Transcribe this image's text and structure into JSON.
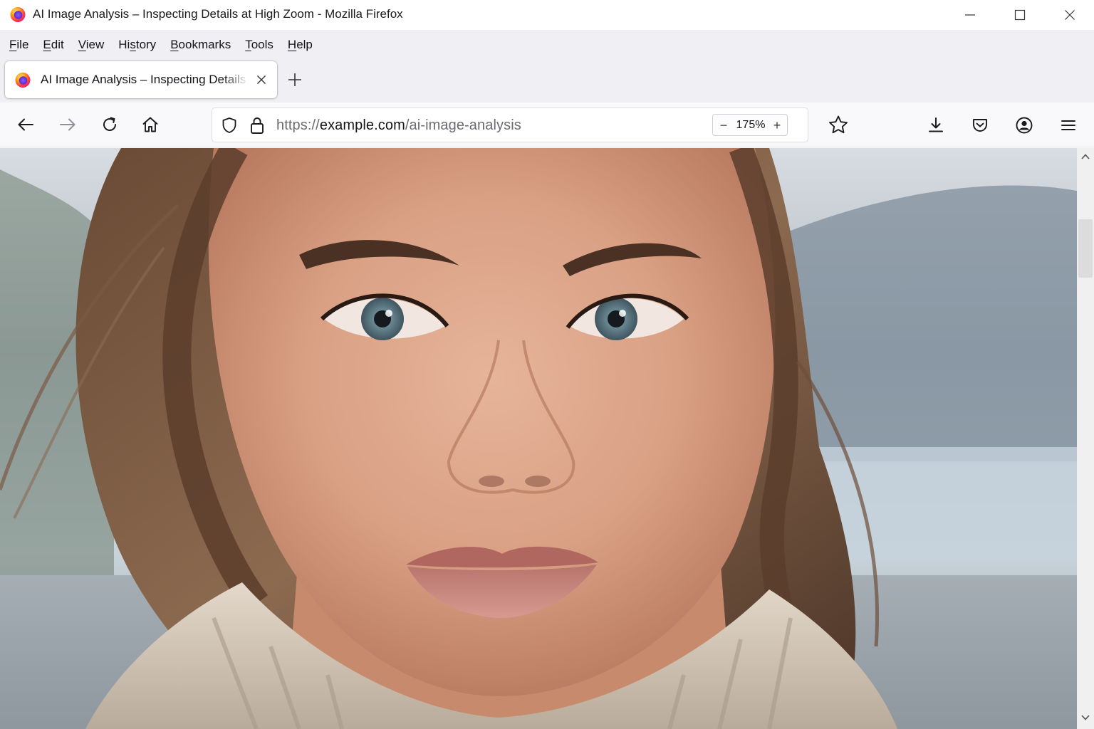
{
  "window": {
    "title": "AI Image Analysis – Inspecting Details at High Zoom - Mozilla Firefox",
    "controls": [
      "minimize",
      "maximize",
      "close"
    ]
  },
  "menu": {
    "items": [
      {
        "mnemonic": "F",
        "rest": "ile"
      },
      {
        "mnemonic": "E",
        "rest": "dit"
      },
      {
        "mnemonic": "V",
        "rest": "iew"
      },
      {
        "pre": "Hi",
        "mnemonic": "s",
        "rest": "tory"
      },
      {
        "mnemonic": "B",
        "rest": "ookmarks"
      },
      {
        "mnemonic": "T",
        "rest": "ools"
      },
      {
        "mnemonic": "H",
        "rest": "elp"
      }
    ]
  },
  "tabs": [
    {
      "title": "AI Image Analysis – Inspecting Details",
      "active": true
    }
  ],
  "urlbar": {
    "scheme": "https://",
    "host": "example.com",
    "path": "/ai-image-analysis"
  },
  "zoom": {
    "minus": "−",
    "value": "175%",
    "plus": "+"
  },
  "icons": {
    "nav": [
      "back-arrow-icon",
      "forward-arrow-icon",
      "reload-icon",
      "home-icon"
    ],
    "url": [
      "tracking-shield-icon",
      "lock-icon"
    ],
    "toolbar": [
      "bookmark-star-icon",
      "download-icon",
      "pocket-icon",
      "account-icon",
      "hamburger-menu-icon"
    ]
  },
  "colors": {
    "chrome_bg": "#f0f0f4",
    "navbar_bg": "#f9f9fb",
    "accent": "#ff7139"
  },
  "content": {
    "image_subject": "close-up portrait of a woman with freckles, blue-grey eyes, brown hair and a knit sweater, shown at 175% zoom"
  }
}
